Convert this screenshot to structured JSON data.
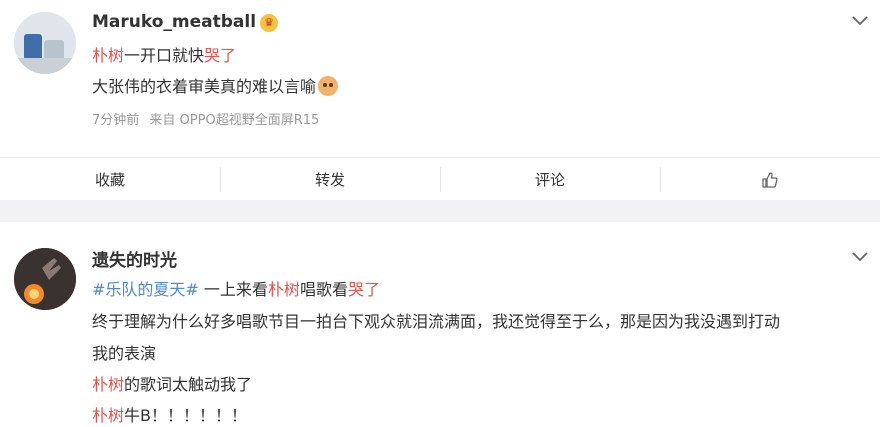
{
  "colors": {
    "highlight": "#e8534b",
    "topic": "#4a8ad8",
    "meta": "#999999",
    "separator": "#f2f2f5"
  },
  "post1": {
    "username": "Maruko_meatball",
    "badge_icon": "crown-icon",
    "line1": {
      "name": "朴树",
      "text": "一开口就快",
      "emph": "哭了"
    },
    "line2": "大张伟的衣着审美真的难以言喻",
    "line2_emoji": "cat-emoji-icon",
    "meta": {
      "time": "7分钟前",
      "source": "来自 OPPO超视野全面屏R15"
    },
    "actions": {
      "favorite": "收藏",
      "repost": "转发",
      "comment": "评论",
      "like_icon": "thumbs-up-icon"
    }
  },
  "post2": {
    "username": "遗失的时光",
    "line1": {
      "topic": "#乐队的夏天#",
      "text1": " 一上来看",
      "name": "朴树",
      "text2": "唱歌看",
      "emph": "哭了"
    },
    "line2": "终于理解为什么好多唱歌节目一拍台下观众就泪流满面，我还觉得至于么，那是因为我没遇到打动",
    "line3": "我的表演",
    "line4": {
      "name": "朴树",
      "text": "的歌词太触动我了"
    },
    "line5": {
      "name": "朴树",
      "text": "牛B！！！！！！"
    }
  }
}
